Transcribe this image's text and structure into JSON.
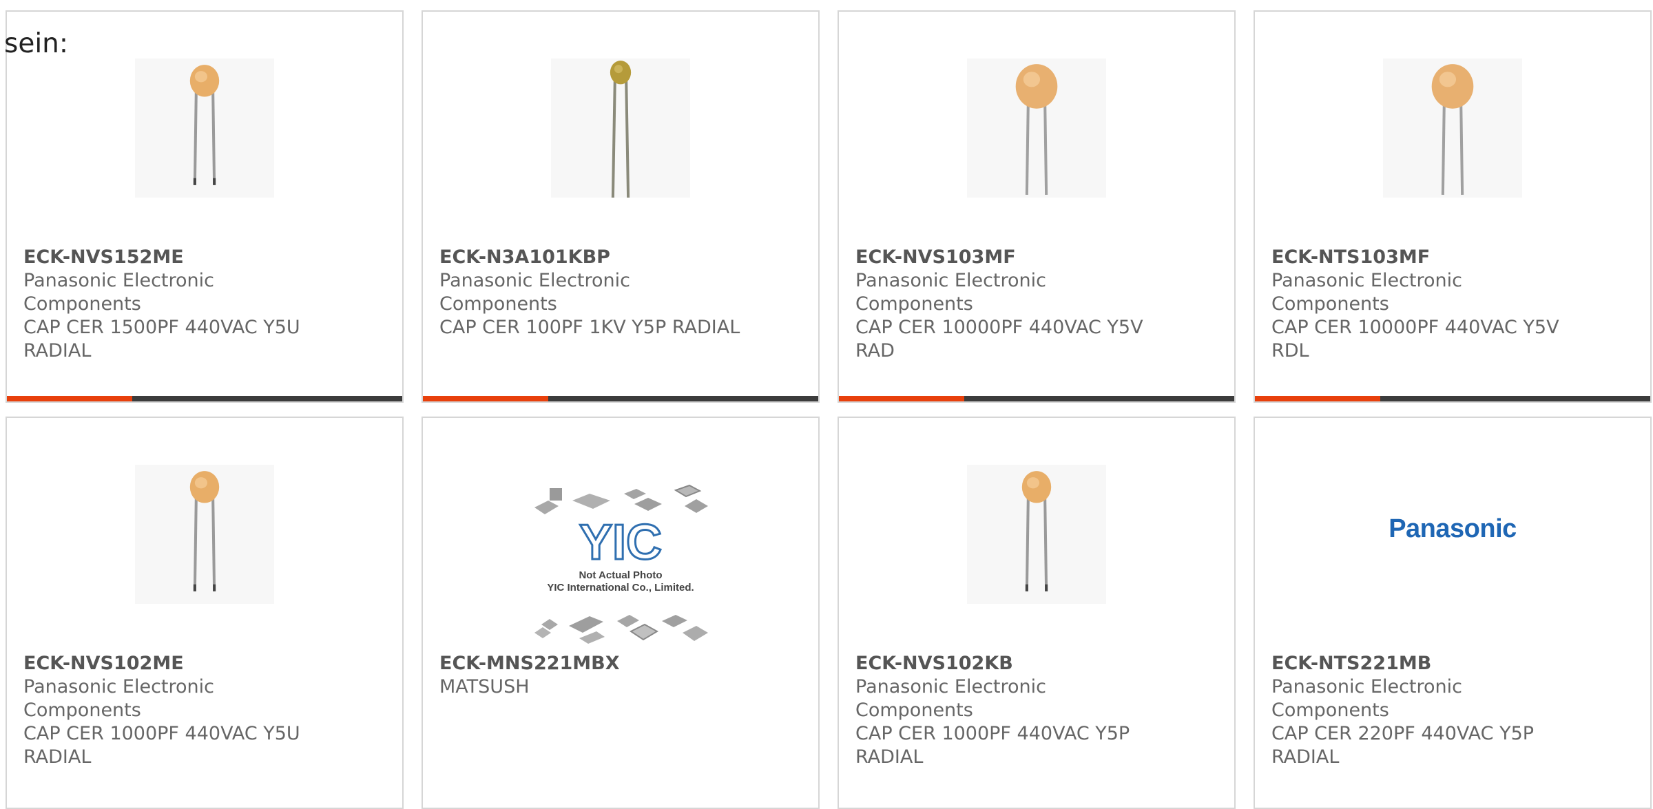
{
  "intro_text": "sein:",
  "colors": {
    "accent": "#e8400c",
    "bar_dark": "#3c3c3c",
    "border": "#d6d6d6",
    "text": "#666666",
    "logo_blue": "#1e66b4"
  },
  "products": [
    {
      "part_number": "ECK-NVS152ME",
      "manufacturer": "Panasonic Electronic Components",
      "description": "CAP CER 1500PF 440VAC Y5U RADIAL",
      "image": "ceramic-disc-capacitor-small"
    },
    {
      "part_number": "ECK-N3A101KBP",
      "manufacturer": "Panasonic Electronic Components",
      "description": "CAP CER 100PF 1KV Y5P RADIAL",
      "image": "ceramic-disc-capacitor-tiny"
    },
    {
      "part_number": "ECK-NVS103MF",
      "manufacturer": "Panasonic Electronic Components",
      "description": "CAP CER 10000PF 440VAC Y5V RAD",
      "image": "ceramic-disc-capacitor-large"
    },
    {
      "part_number": "ECK-NTS103MF",
      "manufacturer": "Panasonic Electronic Components",
      "description": "CAP CER 10000PF 440VAC Y5V RDL",
      "image": "ceramic-disc-capacitor-large"
    },
    {
      "part_number": "ECK-NVS102ME",
      "manufacturer": "Panasonic Electronic Components",
      "description": "CAP CER 1000PF 440VAC Y5U RADIAL",
      "image": "ceramic-disc-capacitor-small"
    },
    {
      "part_number": "ECK-MNS221MBX",
      "manufacturer": "MATSUSH",
      "description": "",
      "image": "yic-placeholder",
      "image_caption_line1": "Not Actual Photo",
      "image_caption_line2": "YIC International Co., Limited.",
      "image_logo_text": "YIC"
    },
    {
      "part_number": "ECK-NVS102KB",
      "manufacturer": "Panasonic Electronic Components",
      "description": "CAP CER 1000PF 440VAC Y5P RADIAL",
      "image": "ceramic-disc-capacitor-small"
    },
    {
      "part_number": "ECK-NTS221MB",
      "manufacturer": "Panasonic Electronic Components",
      "description": "CAP CER 220PF 440VAC Y5P RADIAL",
      "image": "panasonic-logo",
      "image_logo_text": "Panasonic"
    }
  ]
}
